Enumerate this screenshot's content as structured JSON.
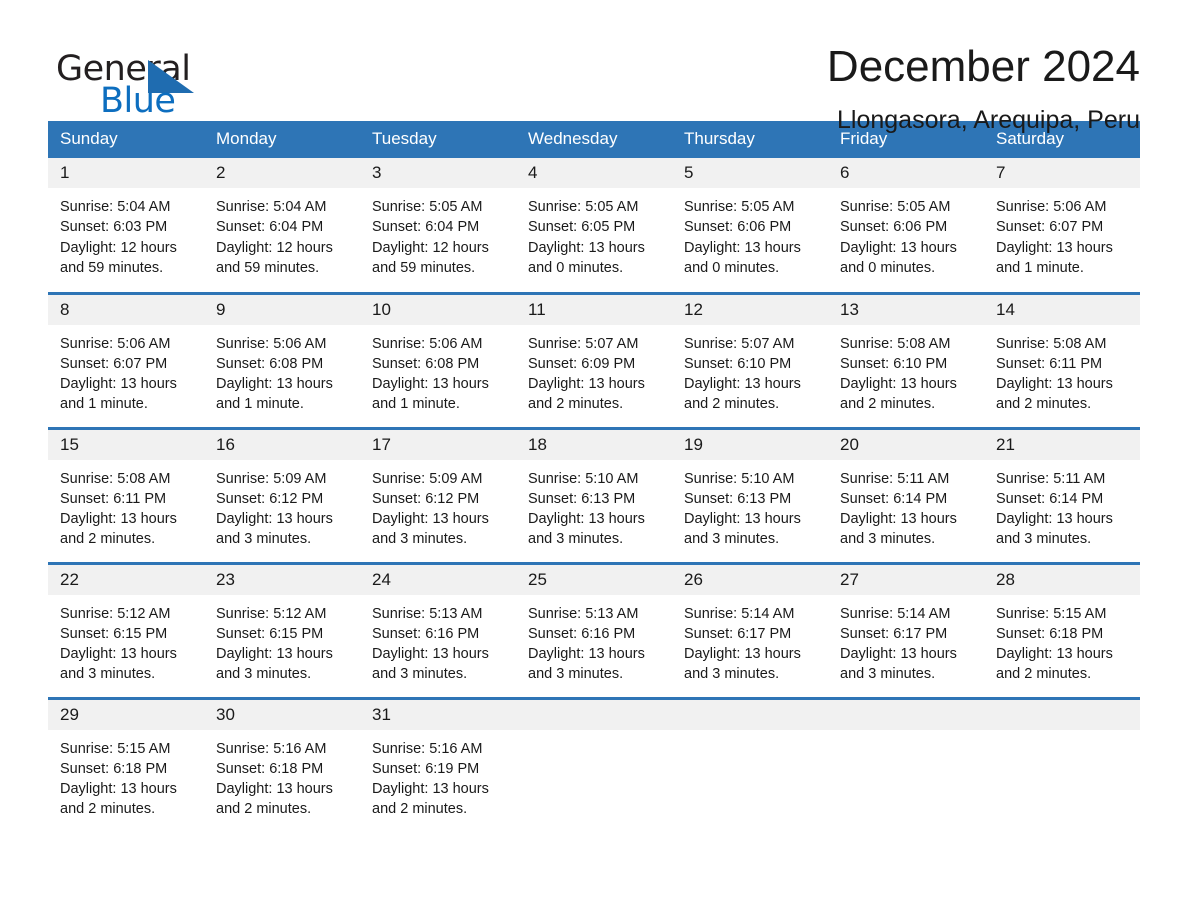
{
  "brand": {
    "name_part1": "General",
    "name_part2": "Blue",
    "accent_color": "#1f6cb0"
  },
  "header": {
    "title": "December 2024",
    "subtitle": "Llongasora, Arequipa, Peru"
  },
  "calendar": {
    "header_color": "#2e75b6",
    "daynum_bg": "#f1f1f1",
    "weekdays": [
      "Sunday",
      "Monday",
      "Tuesday",
      "Wednesday",
      "Thursday",
      "Friday",
      "Saturday"
    ],
    "weeks": [
      [
        {
          "day": "1",
          "sunrise": "Sunrise: 5:04 AM",
          "sunset": "Sunset: 6:03 PM",
          "daylight_line1": "Daylight: 12 hours",
          "daylight_line2": "and 59 minutes."
        },
        {
          "day": "2",
          "sunrise": "Sunrise: 5:04 AM",
          "sunset": "Sunset: 6:04 PM",
          "daylight_line1": "Daylight: 12 hours",
          "daylight_line2": "and 59 minutes."
        },
        {
          "day": "3",
          "sunrise": "Sunrise: 5:05 AM",
          "sunset": "Sunset: 6:04 PM",
          "daylight_line1": "Daylight: 12 hours",
          "daylight_line2": "and 59 minutes."
        },
        {
          "day": "4",
          "sunrise": "Sunrise: 5:05 AM",
          "sunset": "Sunset: 6:05 PM",
          "daylight_line1": "Daylight: 13 hours",
          "daylight_line2": "and 0 minutes."
        },
        {
          "day": "5",
          "sunrise": "Sunrise: 5:05 AM",
          "sunset": "Sunset: 6:06 PM",
          "daylight_line1": "Daylight: 13 hours",
          "daylight_line2": "and 0 minutes."
        },
        {
          "day": "6",
          "sunrise": "Sunrise: 5:05 AM",
          "sunset": "Sunset: 6:06 PM",
          "daylight_line1": "Daylight: 13 hours",
          "daylight_line2": "and 0 minutes."
        },
        {
          "day": "7",
          "sunrise": "Sunrise: 5:06 AM",
          "sunset": "Sunset: 6:07 PM",
          "daylight_line1": "Daylight: 13 hours",
          "daylight_line2": "and 1 minute."
        }
      ],
      [
        {
          "day": "8",
          "sunrise": "Sunrise: 5:06 AM",
          "sunset": "Sunset: 6:07 PM",
          "daylight_line1": "Daylight: 13 hours",
          "daylight_line2": "and 1 minute."
        },
        {
          "day": "9",
          "sunrise": "Sunrise: 5:06 AM",
          "sunset": "Sunset: 6:08 PM",
          "daylight_line1": "Daylight: 13 hours",
          "daylight_line2": "and 1 minute."
        },
        {
          "day": "10",
          "sunrise": "Sunrise: 5:06 AM",
          "sunset": "Sunset: 6:08 PM",
          "daylight_line1": "Daylight: 13 hours",
          "daylight_line2": "and 1 minute."
        },
        {
          "day": "11",
          "sunrise": "Sunrise: 5:07 AM",
          "sunset": "Sunset: 6:09 PM",
          "daylight_line1": "Daylight: 13 hours",
          "daylight_line2": "and 2 minutes."
        },
        {
          "day": "12",
          "sunrise": "Sunrise: 5:07 AM",
          "sunset": "Sunset: 6:10 PM",
          "daylight_line1": "Daylight: 13 hours",
          "daylight_line2": "and 2 minutes."
        },
        {
          "day": "13",
          "sunrise": "Sunrise: 5:08 AM",
          "sunset": "Sunset: 6:10 PM",
          "daylight_line1": "Daylight: 13 hours",
          "daylight_line2": "and 2 minutes."
        },
        {
          "day": "14",
          "sunrise": "Sunrise: 5:08 AM",
          "sunset": "Sunset: 6:11 PM",
          "daylight_line1": "Daylight: 13 hours",
          "daylight_line2": "and 2 minutes."
        }
      ],
      [
        {
          "day": "15",
          "sunrise": "Sunrise: 5:08 AM",
          "sunset": "Sunset: 6:11 PM",
          "daylight_line1": "Daylight: 13 hours",
          "daylight_line2": "and 2 minutes."
        },
        {
          "day": "16",
          "sunrise": "Sunrise: 5:09 AM",
          "sunset": "Sunset: 6:12 PM",
          "daylight_line1": "Daylight: 13 hours",
          "daylight_line2": "and 3 minutes."
        },
        {
          "day": "17",
          "sunrise": "Sunrise: 5:09 AM",
          "sunset": "Sunset: 6:12 PM",
          "daylight_line1": "Daylight: 13 hours",
          "daylight_line2": "and 3 minutes."
        },
        {
          "day": "18",
          "sunrise": "Sunrise: 5:10 AM",
          "sunset": "Sunset: 6:13 PM",
          "daylight_line1": "Daylight: 13 hours",
          "daylight_line2": "and 3 minutes."
        },
        {
          "day": "19",
          "sunrise": "Sunrise: 5:10 AM",
          "sunset": "Sunset: 6:13 PM",
          "daylight_line1": "Daylight: 13 hours",
          "daylight_line2": "and 3 minutes."
        },
        {
          "day": "20",
          "sunrise": "Sunrise: 5:11 AM",
          "sunset": "Sunset: 6:14 PM",
          "daylight_line1": "Daylight: 13 hours",
          "daylight_line2": "and 3 minutes."
        },
        {
          "day": "21",
          "sunrise": "Sunrise: 5:11 AM",
          "sunset": "Sunset: 6:14 PM",
          "daylight_line1": "Daylight: 13 hours",
          "daylight_line2": "and 3 minutes."
        }
      ],
      [
        {
          "day": "22",
          "sunrise": "Sunrise: 5:12 AM",
          "sunset": "Sunset: 6:15 PM",
          "daylight_line1": "Daylight: 13 hours",
          "daylight_line2": "and 3 minutes."
        },
        {
          "day": "23",
          "sunrise": "Sunrise: 5:12 AM",
          "sunset": "Sunset: 6:15 PM",
          "daylight_line1": "Daylight: 13 hours",
          "daylight_line2": "and 3 minutes."
        },
        {
          "day": "24",
          "sunrise": "Sunrise: 5:13 AM",
          "sunset": "Sunset: 6:16 PM",
          "daylight_line1": "Daylight: 13 hours",
          "daylight_line2": "and 3 minutes."
        },
        {
          "day": "25",
          "sunrise": "Sunrise: 5:13 AM",
          "sunset": "Sunset: 6:16 PM",
          "daylight_line1": "Daylight: 13 hours",
          "daylight_line2": "and 3 minutes."
        },
        {
          "day": "26",
          "sunrise": "Sunrise: 5:14 AM",
          "sunset": "Sunset: 6:17 PM",
          "daylight_line1": "Daylight: 13 hours",
          "daylight_line2": "and 3 minutes."
        },
        {
          "day": "27",
          "sunrise": "Sunrise: 5:14 AM",
          "sunset": "Sunset: 6:17 PM",
          "daylight_line1": "Daylight: 13 hours",
          "daylight_line2": "and 3 minutes."
        },
        {
          "day": "28",
          "sunrise": "Sunrise: 5:15 AM",
          "sunset": "Sunset: 6:18 PM",
          "daylight_line1": "Daylight: 13 hours",
          "daylight_line2": "and 2 minutes."
        }
      ],
      [
        {
          "day": "29",
          "sunrise": "Sunrise: 5:15 AM",
          "sunset": "Sunset: 6:18 PM",
          "daylight_line1": "Daylight: 13 hours",
          "daylight_line2": "and 2 minutes."
        },
        {
          "day": "30",
          "sunrise": "Sunrise: 5:16 AM",
          "sunset": "Sunset: 6:18 PM",
          "daylight_line1": "Daylight: 13 hours",
          "daylight_line2": "and 2 minutes."
        },
        {
          "day": "31",
          "sunrise": "Sunrise: 5:16 AM",
          "sunset": "Sunset: 6:19 PM",
          "daylight_line1": "Daylight: 13 hours",
          "daylight_line2": "and 2 minutes."
        },
        {
          "day": "",
          "sunrise": "",
          "sunset": "",
          "daylight_line1": "",
          "daylight_line2": ""
        },
        {
          "day": "",
          "sunrise": "",
          "sunset": "",
          "daylight_line1": "",
          "daylight_line2": ""
        },
        {
          "day": "",
          "sunrise": "",
          "sunset": "",
          "daylight_line1": "",
          "daylight_line2": ""
        },
        {
          "day": "",
          "sunrise": "",
          "sunset": "",
          "daylight_line1": "",
          "daylight_line2": ""
        }
      ]
    ]
  }
}
